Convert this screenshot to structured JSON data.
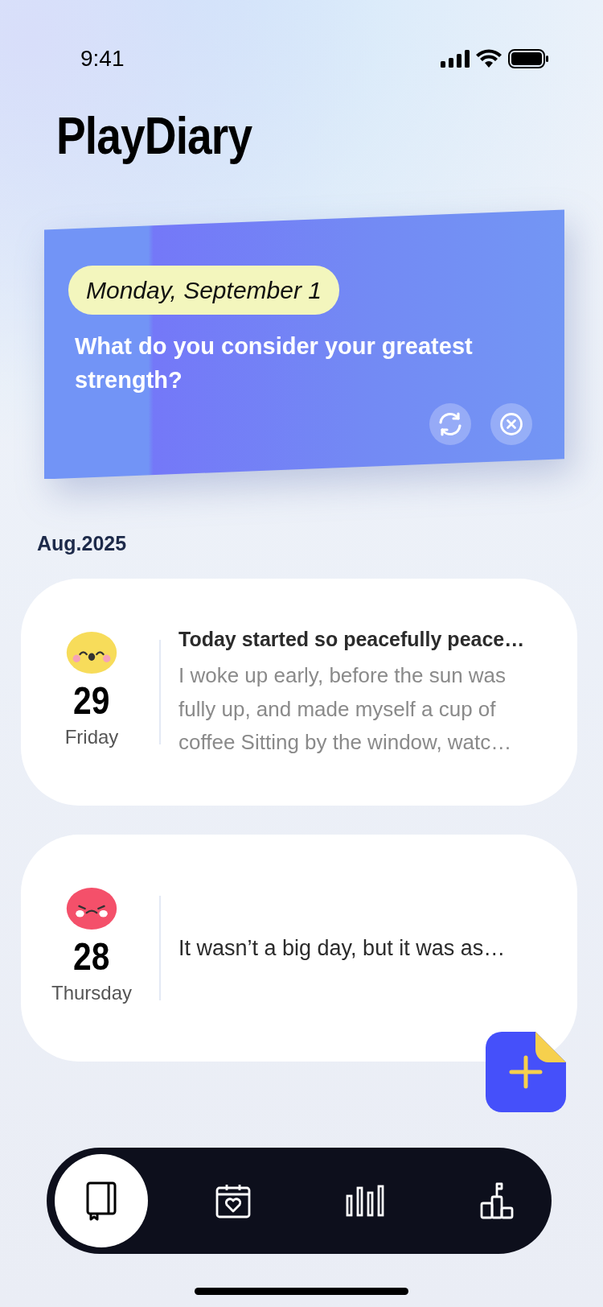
{
  "status_bar": {
    "time": "9:41"
  },
  "app_title": "PlayDiary",
  "prompt_card": {
    "date": "Monday, September 1",
    "question": "What do you consider your greatest strength?"
  },
  "month": "Aug.2025",
  "entries": [
    {
      "kind": "happy",
      "color": "#f7dc5a",
      "day": "29",
      "weekday": "Friday",
      "title": "Today started so peacefully peace…",
      "body": "I woke up early, before the sun was fully up, and made myself a cup of coffee Sitting by the window, watc…"
    },
    {
      "kind": "angry",
      "color": "#f4506a",
      "day": "28",
      "weekday": "Thursday",
      "title": "It wasn’t a big day, but it was as…"
    }
  ],
  "nav": [
    {
      "kind": "diary",
      "selected": true
    },
    {
      "kind": "calendar",
      "selected": false
    },
    {
      "kind": "stats",
      "selected": false
    },
    {
      "kind": "ranking",
      "selected": false
    }
  ]
}
